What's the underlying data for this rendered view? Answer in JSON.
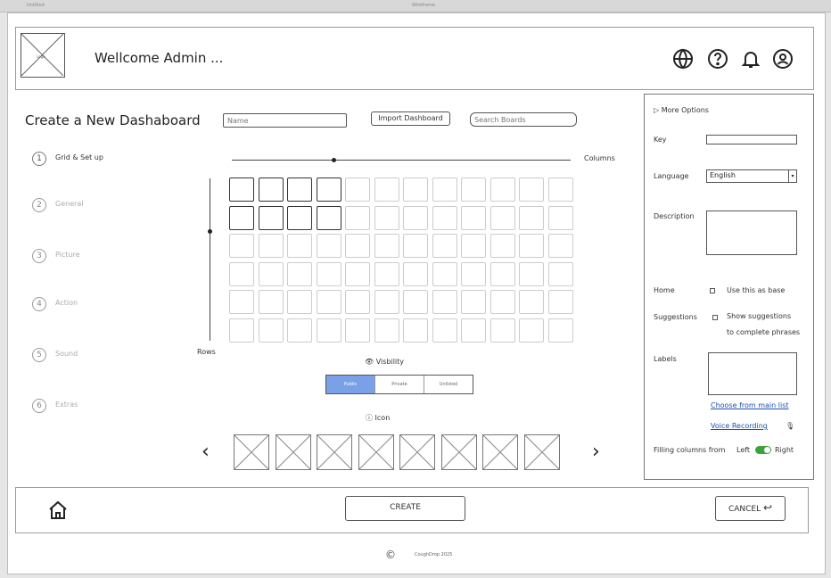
{
  "window": {
    "chrome_left": "Untitled",
    "chrome_center": "Wireframe"
  },
  "header": {
    "logo_text": "Logo",
    "welcome": "Wellcome Admin ..."
  },
  "main": {
    "title": "Create a New Dashaboard",
    "name_placeholder": "Name",
    "import_label": "Import Dashboard",
    "search_placeholder": "Search Boards",
    "steps": [
      {
        "num": "1",
        "label": "Grid & Set up"
      },
      {
        "num": "2",
        "label": "General"
      },
      {
        "num": "3",
        "label": "Picture"
      },
      {
        "num": "4",
        "label": "Action"
      },
      {
        "num": "5",
        "label": "Sound"
      },
      {
        "num": "6",
        "label": "Extras"
      }
    ],
    "columns_label": "Columns",
    "rows_label": "Rows",
    "visibility_label": "Visbility",
    "visibility_options": [
      "Public",
      "Private",
      "Unlisted"
    ],
    "icon_label": "Icon"
  },
  "right_panel": {
    "more_options": "More Options",
    "key_label": "Key",
    "language_label": "Language",
    "language_value": "English",
    "description_label": "Description",
    "home_label": "Home",
    "home_check": "Use this as base",
    "suggestions_label": "Suggestions",
    "suggestions_check_1": "Show suggestions",
    "suggestions_check_2": "to complete phrases",
    "labels_label": "Labels",
    "choose_link": "Choose from main list",
    "voice_link": "Voice Recording",
    "filling_label": "Filling columns from",
    "left_label": "Left",
    "right_label": "Right"
  },
  "footer": {
    "create_label": "CREATE",
    "cancel_label": "CANCEL",
    "copyright_symbol": "©",
    "copyright_text": "CoughDrop 2025"
  },
  "colors": {
    "toggle_on": "#3aa33a",
    "link": "#1a4fb5",
    "visibility_active": "#7aa0e8"
  }
}
